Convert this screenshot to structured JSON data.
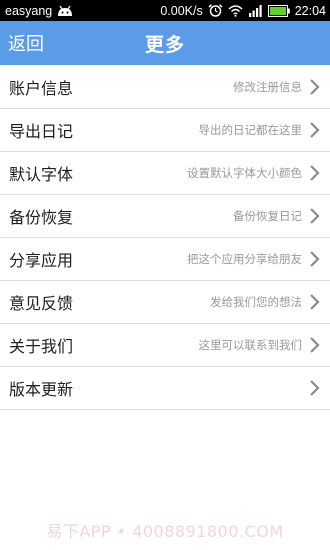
{
  "status_bar": {
    "carrier": "easyang",
    "speed": "0.00K/s",
    "time": "22:04"
  },
  "header": {
    "back_label": "返回",
    "title": "更多"
  },
  "menu": {
    "items": [
      {
        "title": "账户信息",
        "desc": "修改注册信息"
      },
      {
        "title": "导出日记",
        "desc": "导出的日记都在这里"
      },
      {
        "title": "默认字体",
        "desc": "设置默认字体大小颜色"
      },
      {
        "title": "备份恢复",
        "desc": "备份恢复日记"
      },
      {
        "title": "分享应用",
        "desc": "把这个应用分享给朋友"
      },
      {
        "title": "意见反馈",
        "desc": "发给我们您的想法"
      },
      {
        "title": "关于我们",
        "desc": "这里可以联系到我们"
      },
      {
        "title": "版本更新",
        "desc": ""
      }
    ]
  },
  "watermark": "易下APP • 4008891800.COM",
  "colors": {
    "header_bg": "#5a9ce8",
    "divider": "#dcdcdc",
    "desc_text": "#9a9a9a",
    "battery": "#5fd12b"
  },
  "icons": {
    "status": [
      "android-icon",
      "alarm-icon",
      "wifi-icon",
      "signal-icon",
      "battery-icon"
    ],
    "row": "chevron-right-icon"
  }
}
